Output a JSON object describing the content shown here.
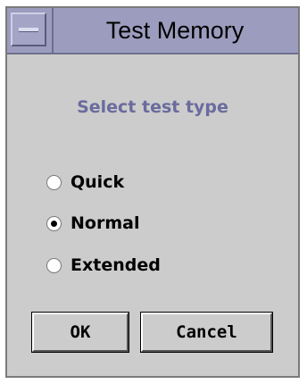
{
  "window": {
    "title": "Test Memory",
    "menu_icon": "window-menu-icon"
  },
  "dialog": {
    "prompt": "Select test type",
    "options": [
      {
        "label": "Quick",
        "selected": false
      },
      {
        "label": "Normal",
        "selected": true
      },
      {
        "label": "Extended",
        "selected": false
      }
    ]
  },
  "buttons": {
    "ok_label": "OK",
    "cancel_label": "Cancel"
  },
  "colors": {
    "titlebar": "#9c9cbe",
    "dialog_bg": "#cccccc",
    "prompt_text": "#6b6b9e"
  }
}
